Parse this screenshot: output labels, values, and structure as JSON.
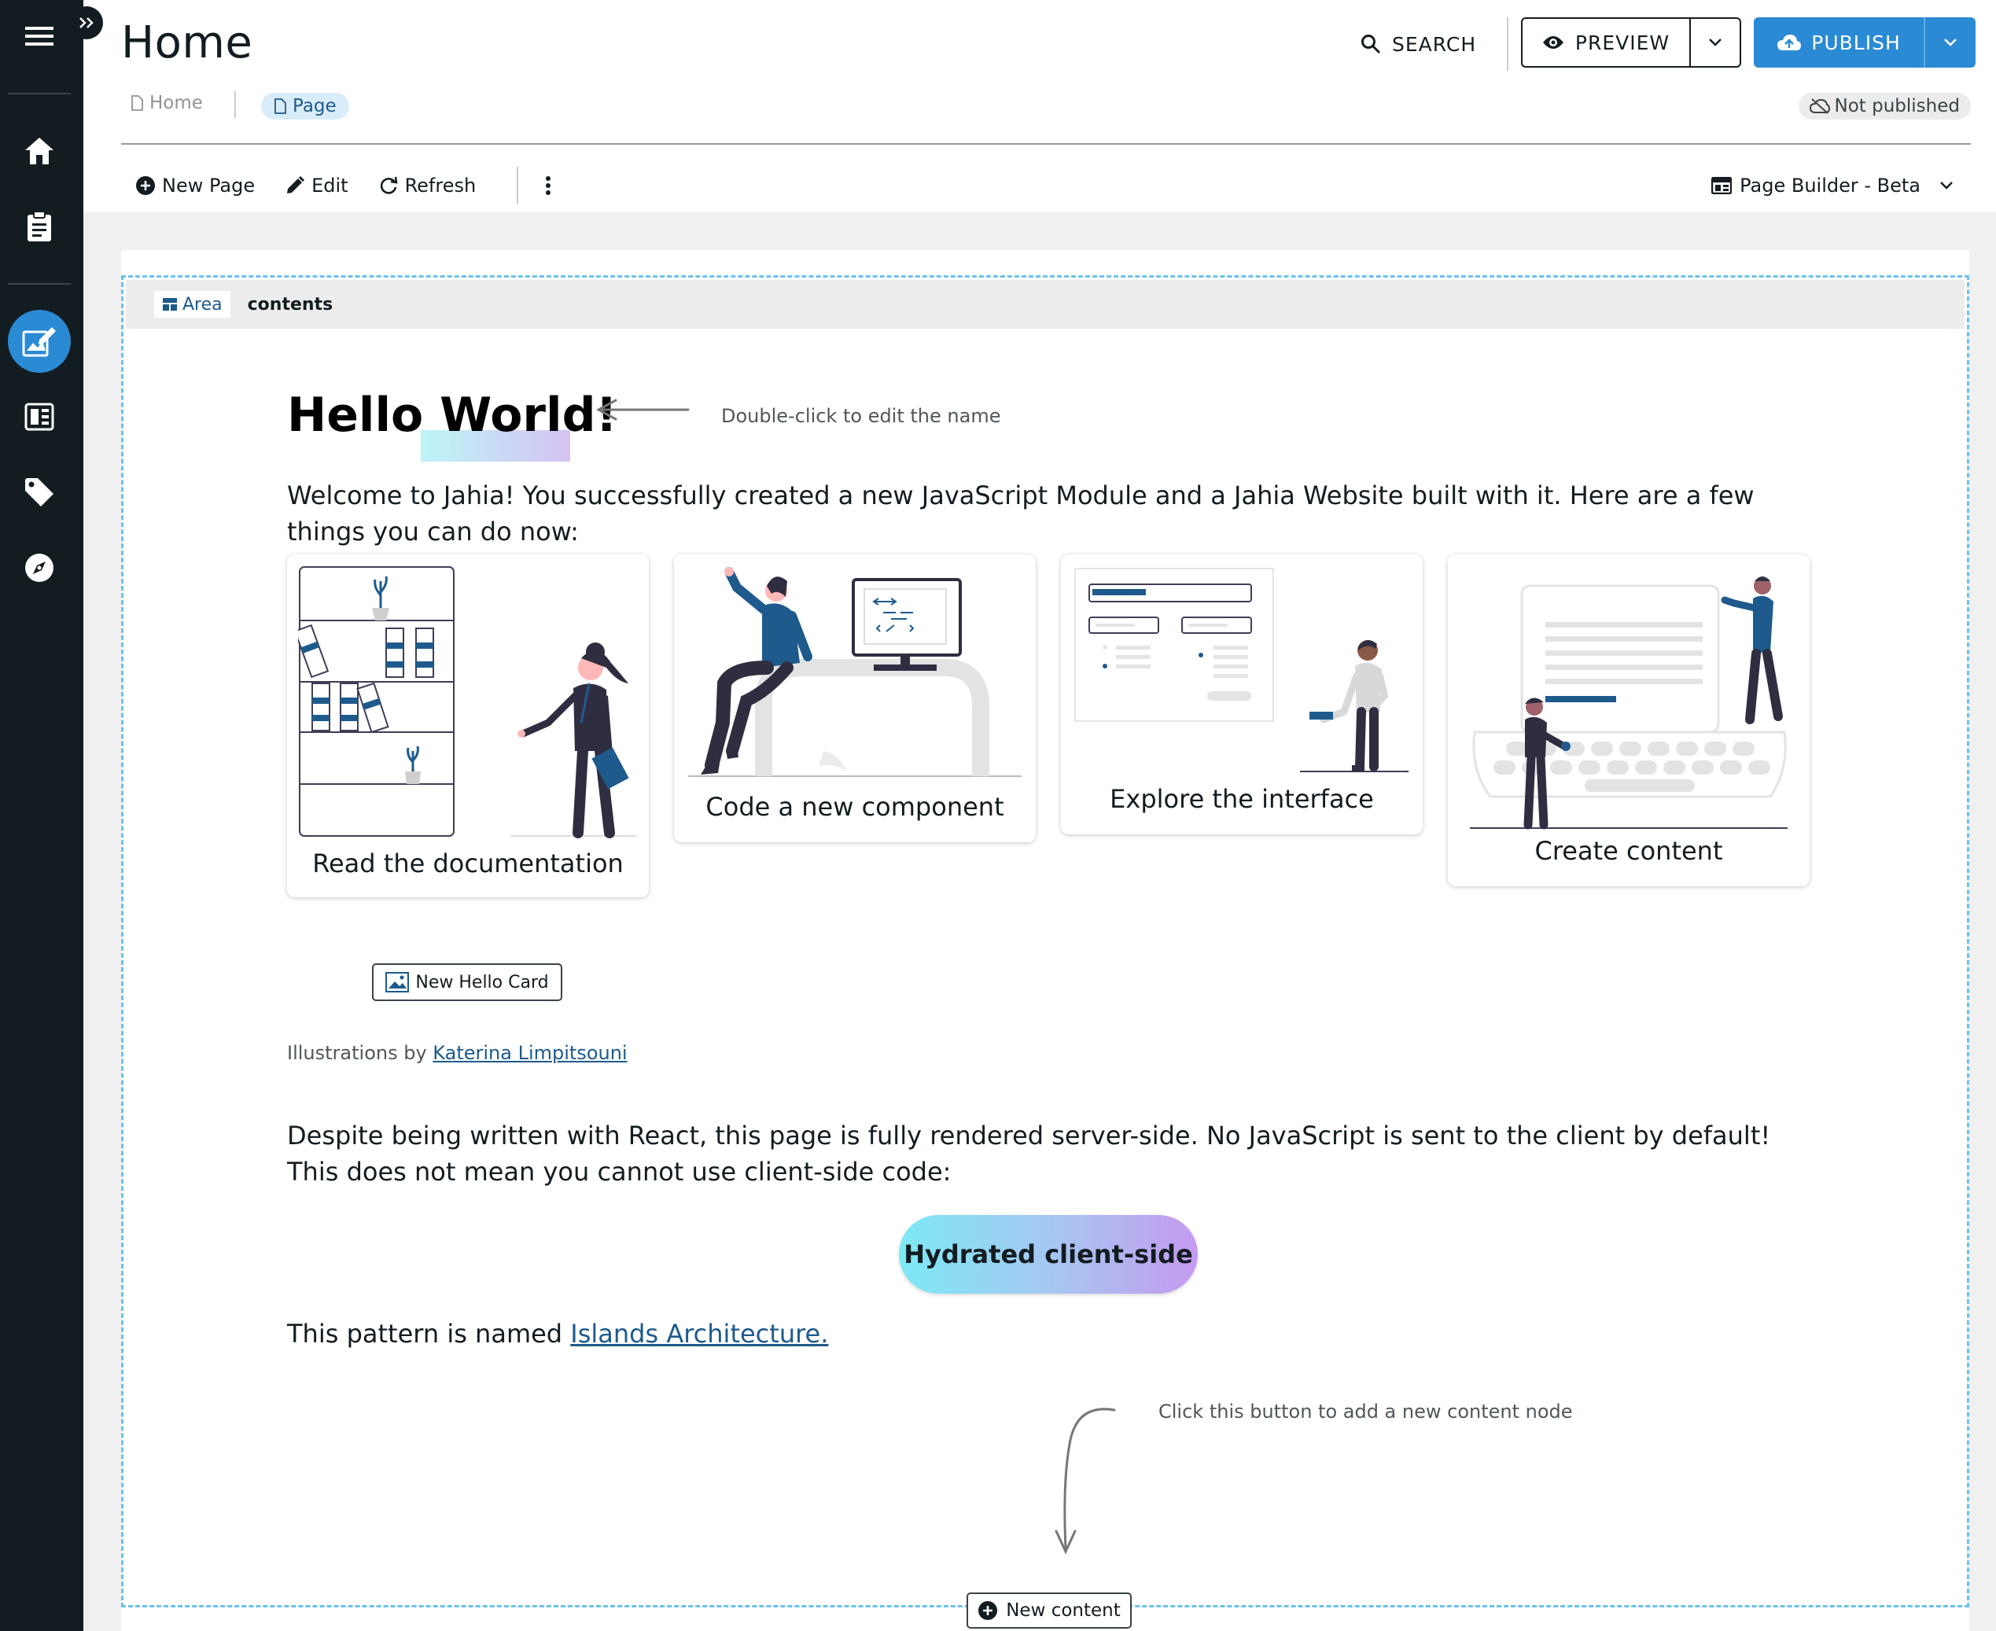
{
  "nav": {
    "items": [
      "menu-icon",
      "home-icon",
      "clipboard-icon",
      "page-composer-icon",
      "content-grid-icon",
      "tag-icon",
      "compass-icon"
    ],
    "active": "page-composer-icon"
  },
  "header": {
    "title": "Home",
    "search_label": "SEARCH",
    "preview_label": "PREVIEW",
    "publish_label": "PUBLISH",
    "status": "Not published",
    "breadcrumbs": [
      {
        "label": "Home"
      },
      {
        "label": "Page"
      }
    ]
  },
  "toolbar": {
    "new_page": "New Page",
    "edit": "Edit",
    "refresh": "Refresh",
    "view_selector": "Page Builder - Beta"
  },
  "area": {
    "badge": "Area",
    "name": "contents"
  },
  "content": {
    "heading": "Hello World!",
    "heading_hint": "Double-click to edit the name",
    "intro": "Welcome to Jahia! You successfully created a new JavaScript Module and a Jahia Website built with it. Here are a few things you can do now:",
    "cards": [
      {
        "title": "Read the documentation"
      },
      {
        "title": "Code a new component"
      },
      {
        "title": "Explore the interface"
      },
      {
        "title": "Create content"
      }
    ],
    "new_hello_card": "New Hello Card",
    "credit_prefix": "Illustrations by ",
    "credit_link": "Katerina Limpitsouni",
    "server_side_text": "Despite being written with React, this page is fully rendered server-side. No JavaScript is sent to the client by default! This does not mean you cannot use client-side code:",
    "hydrated_button": "Hydrated client-side",
    "pattern_prefix": "This pattern is named ",
    "pattern_link": "Islands Architecture.",
    "add_hint": "Click this button to add a new content node",
    "new_content": "New content"
  },
  "colors": {
    "nav_bg": "#131c21",
    "accent": "#2a8ad4",
    "link": "#1e5a8c",
    "area_border": "#6cc1ea"
  }
}
